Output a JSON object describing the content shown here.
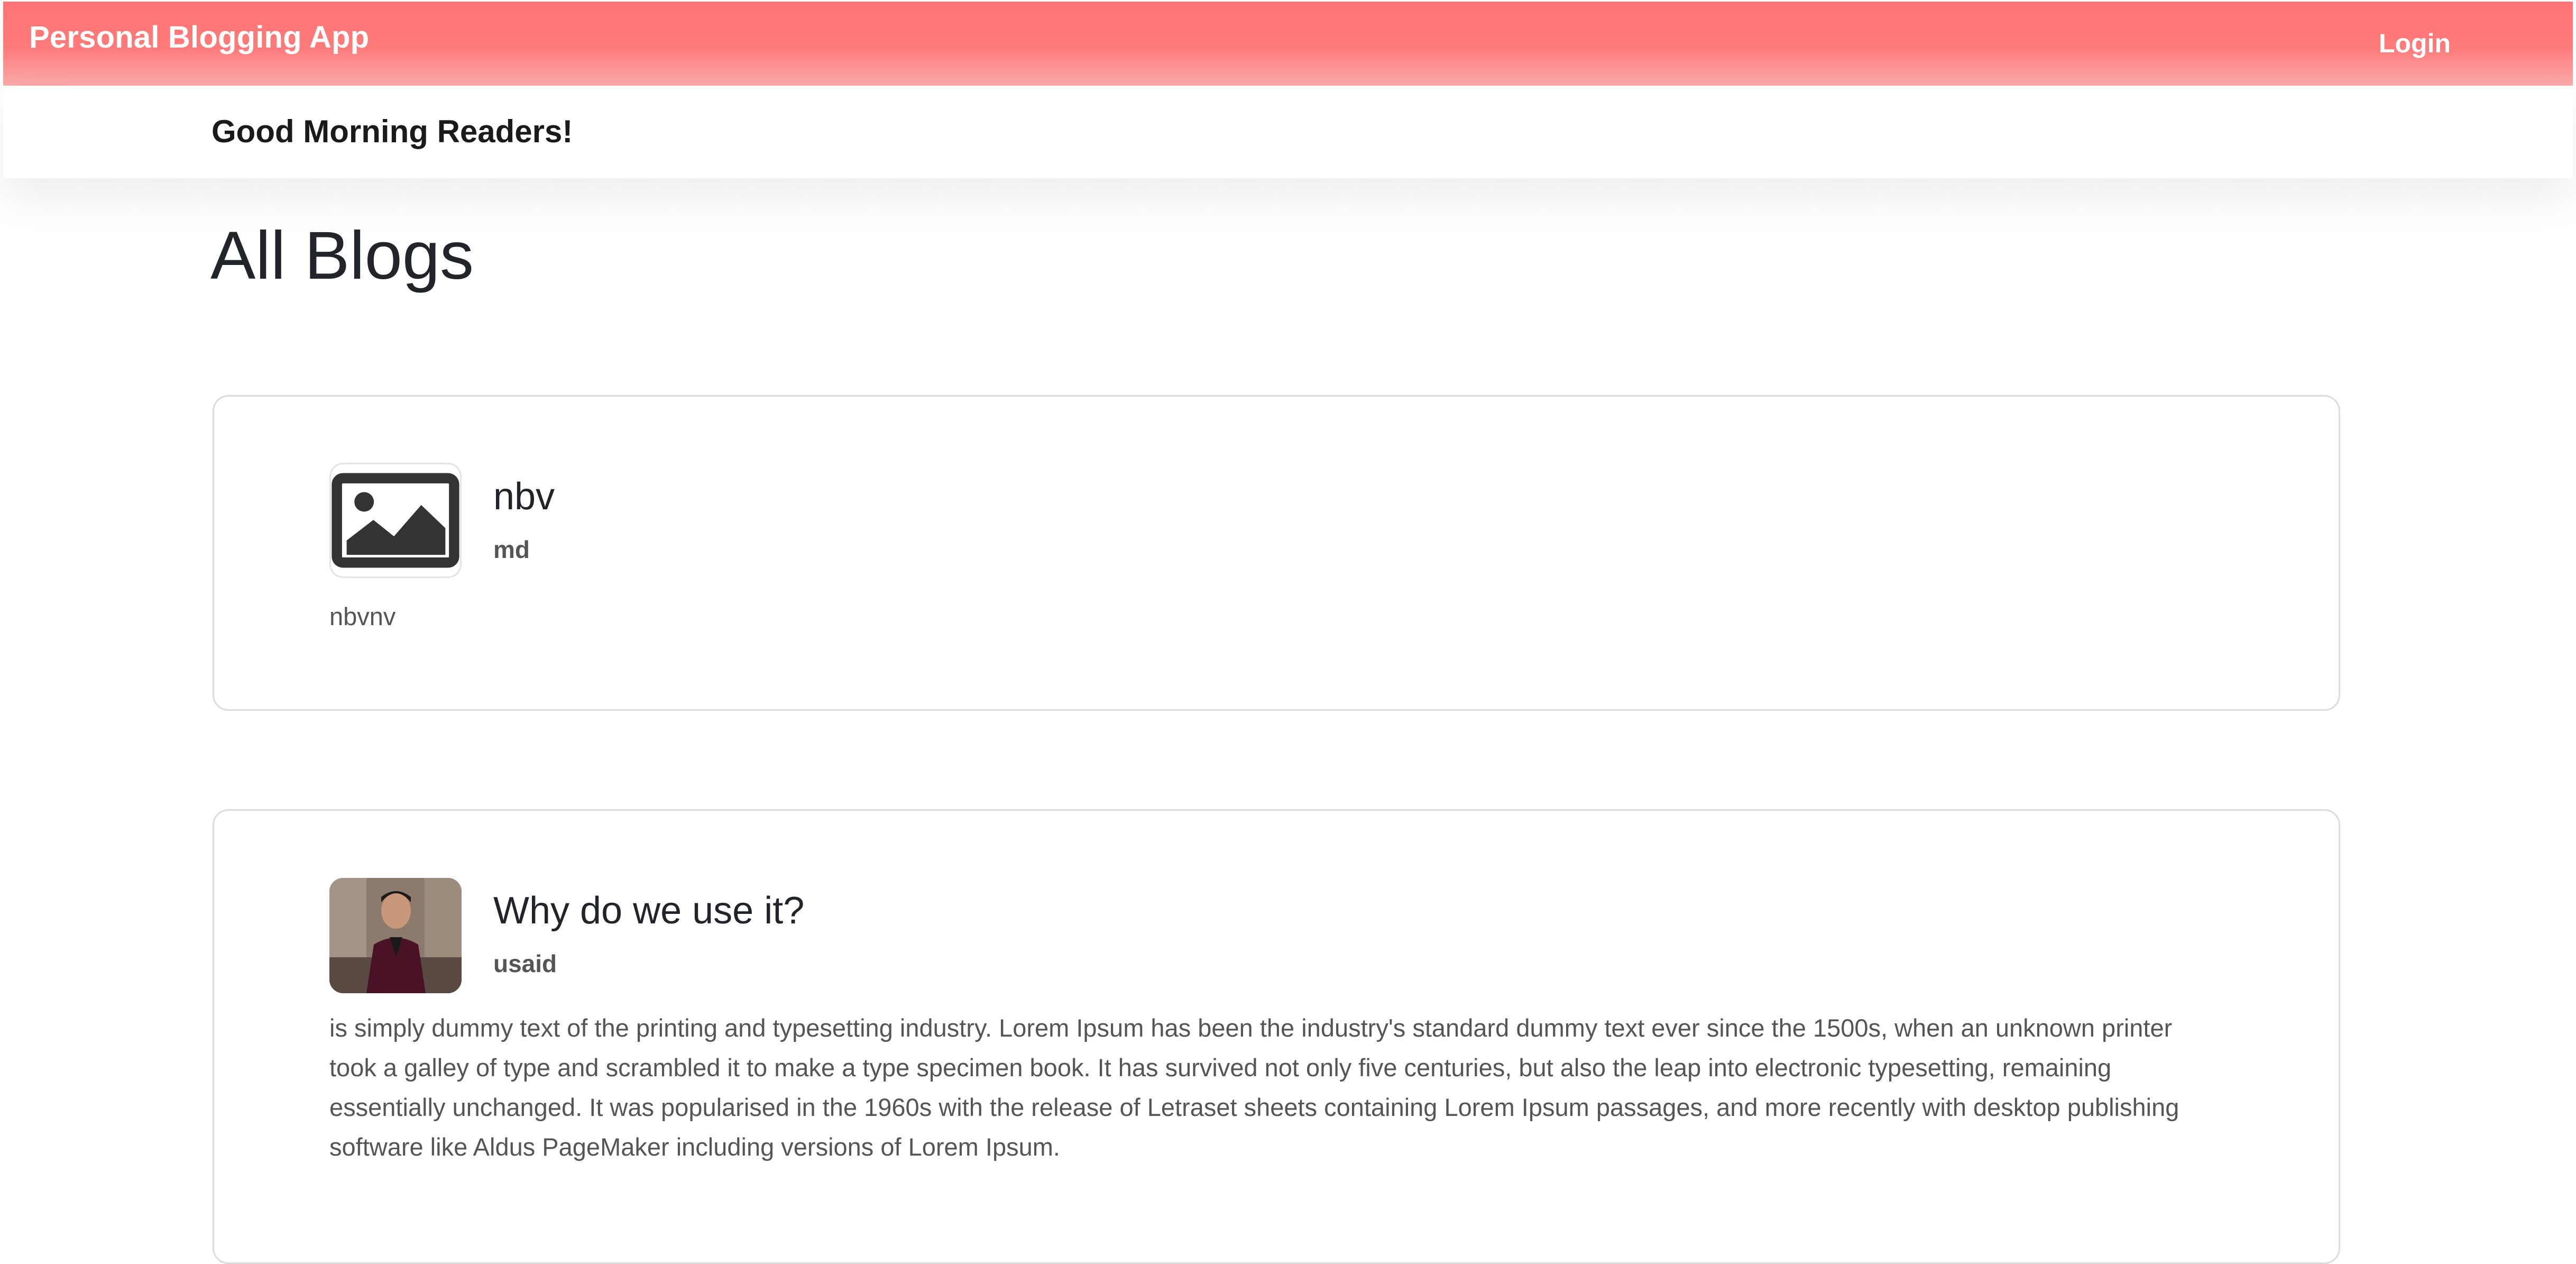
{
  "header": {
    "brand": "Personal Blogging App",
    "login_label": "Login"
  },
  "greeting": "Good Morning Readers!",
  "page_title": "All Blogs",
  "posts": [
    {
      "title": "nbv",
      "author": "md",
      "body": "nbvnv",
      "image": "placeholder-image-icon"
    },
    {
      "title": "Why do we use it?",
      "author": "usaid",
      "body": "is simply dummy text of the printing and typesetting industry. Lorem Ipsum has been the industry's standard dummy text ever since the 1500s, when an unknown printer took a galley of type and scrambled it to make a type specimen book. It has survived not only five centuries, but also the leap into electronic typesetting, remaining essentially unchanged. It was popularised in the 1960s with the release of Letraset sheets containing Lorem Ipsum passages, and more recently with desktop publishing software like Aldus PageMaker including versions of Lorem Ipsum.",
      "image": "author-photo"
    }
  ],
  "colors": {
    "navbar": "#ff7474",
    "navbar_fade": "#faaaaa",
    "card_border": "#dcdcdc"
  }
}
